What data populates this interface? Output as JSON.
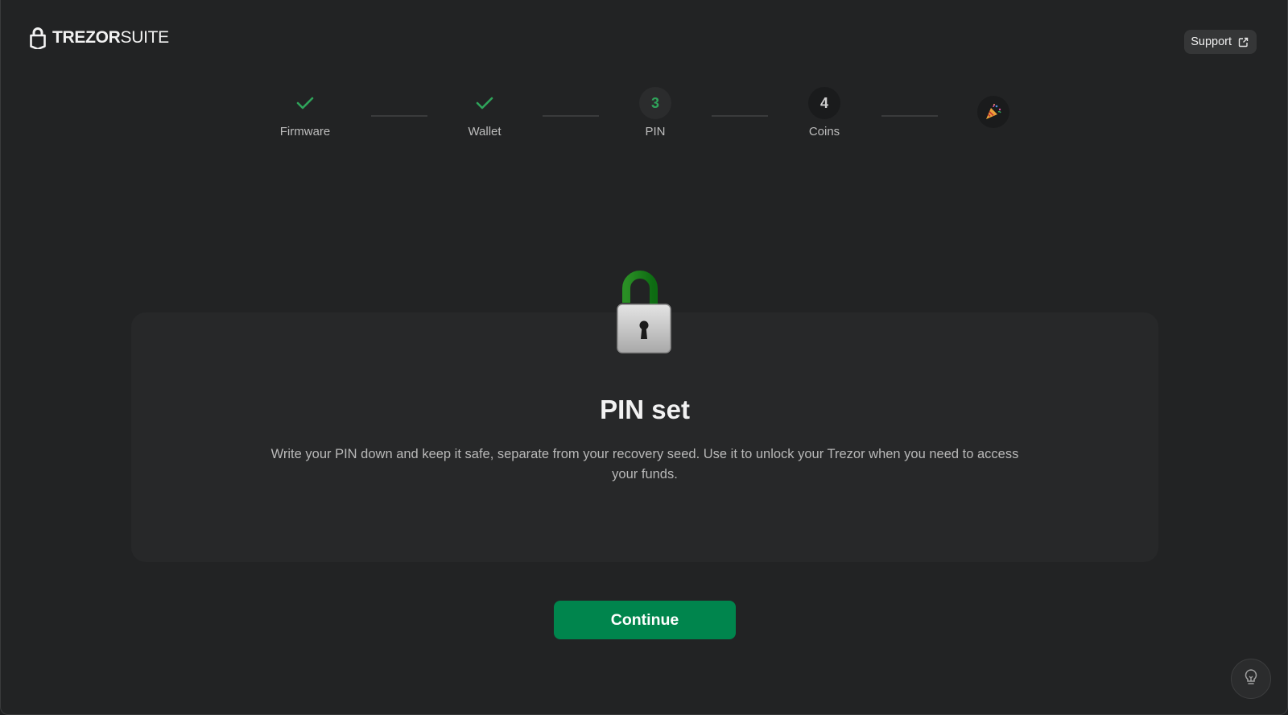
{
  "header": {
    "logo_bold": "TREZOR",
    "logo_light": "SUITE",
    "support_label": "Support"
  },
  "stepper": {
    "steps": [
      {
        "label": "Firmware",
        "state": "done",
        "number": ""
      },
      {
        "label": "Wallet",
        "state": "done",
        "number": ""
      },
      {
        "label": "PIN",
        "state": "active",
        "number": "3"
      },
      {
        "label": "Coins",
        "state": "pending",
        "number": "4"
      }
    ],
    "final_icon": "party-popper-icon"
  },
  "card": {
    "icon": "unlocked-padlock-icon",
    "title": "PIN set",
    "text": "Write your PIN down and keep it safe, separate from your recovery seed. Use it to unlock your Trezor when you need to access your funds."
  },
  "actions": {
    "continue_label": "Continue"
  },
  "colors": {
    "accent_green": "#00854d",
    "check_green": "#2fa35a",
    "background": "#222324",
    "card": "#272829"
  }
}
